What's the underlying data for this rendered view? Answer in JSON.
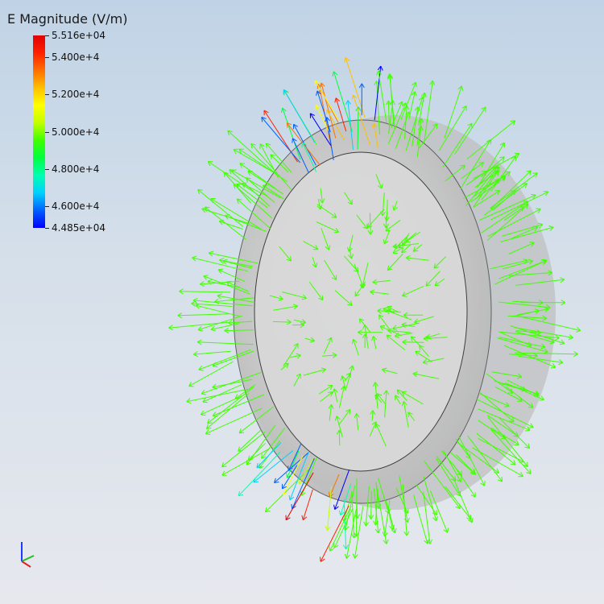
{
  "chart_data": {
    "type": "vector-field",
    "title": "E Magnitude (V/m)",
    "color_range": [
      44850,
      55160
    ],
    "colormap": [
      "#0000ff",
      "#0060ff",
      "#00d0ff",
      "#00ffb0",
      "#00ff40",
      "#40ff00",
      "#c0ff00",
      "#ffff00",
      "#ffc000",
      "#ff7000",
      "#ff2000",
      "#e00000"
    ],
    "colorbar_ticks": [
      {
        "value": 55160,
        "label": "5.516e+04"
      },
      {
        "value": 54000,
        "label": "5.400e+4"
      },
      {
        "value": 52000,
        "label": "5.200e+4"
      },
      {
        "value": 50000,
        "label": "5.000e+4"
      },
      {
        "value": 48000,
        "label": "4.800e+4"
      },
      {
        "value": 46000,
        "label": "4.600e+4"
      },
      {
        "value": 44850,
        "label": "4.485e+04"
      }
    ],
    "background": {
      "top": "#c0d3e6",
      "bottom": "#e3e6ec"
    },
    "ring_color": "#c8c8c8",
    "axes_triad_icon": "axes-triad-icon"
  }
}
